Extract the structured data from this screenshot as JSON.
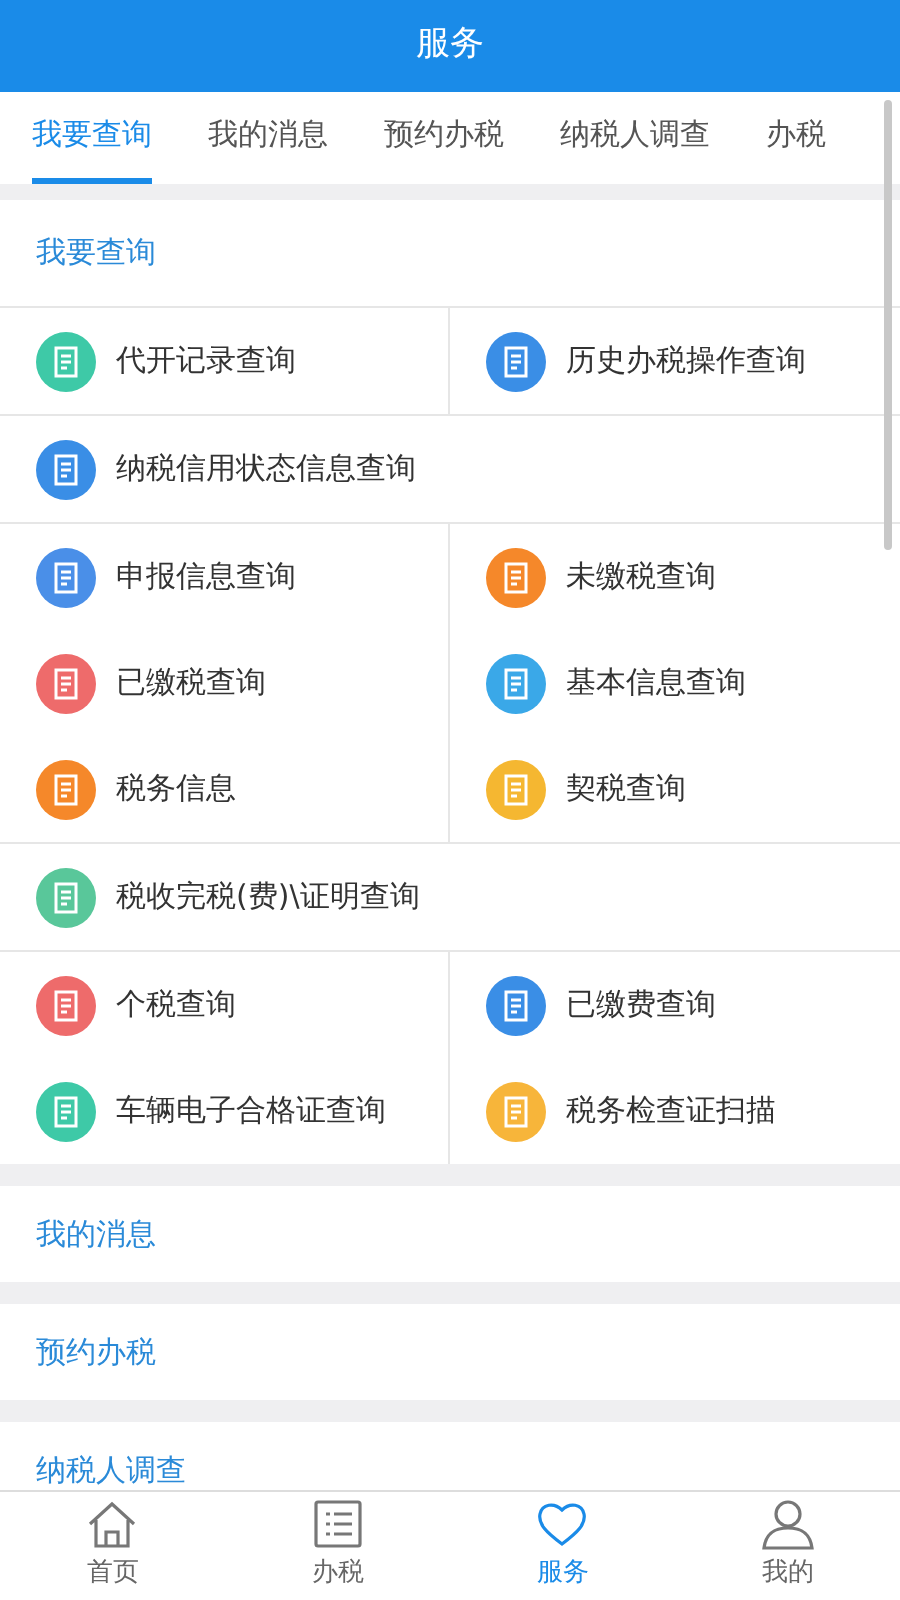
{
  "header": {
    "title": "服务"
  },
  "tabs": [
    {
      "label": "我要查询",
      "selected": true
    },
    {
      "label": "我的消息",
      "selected": false
    },
    {
      "label": "预约办税",
      "selected": false
    },
    {
      "label": "纳税人调查",
      "selected": false
    },
    {
      "label": "办税",
      "selected": false
    }
  ],
  "query_section": {
    "title": "我要查询",
    "blocks": [
      {
        "items": [
          {
            "label": "代开记录查询",
            "color": "#3ec9a7"
          },
          {
            "label": "历史办税操作查询",
            "color": "#3a8ee6"
          }
        ]
      },
      {
        "items": [
          {
            "label": "纳税信用状态信息查询",
            "color": "#3a8ee6"
          }
        ]
      },
      {
        "items": [
          {
            "label": "申报信息查询",
            "color": "#4a8fe8"
          },
          {
            "label": "未缴税查询",
            "color": "#f5882a"
          },
          {
            "label": "已缴税查询",
            "color": "#ee6b6b"
          },
          {
            "label": "基本信息查询",
            "color": "#3aa8e8"
          },
          {
            "label": "税务信息",
            "color": "#f5882a"
          },
          {
            "label": "契税查询",
            "color": "#f5b731"
          }
        ]
      },
      {
        "items": [
          {
            "label": "税收完税(费)\\证明查询",
            "color": "#59c79a"
          }
        ]
      },
      {
        "items": [
          {
            "label": "个税查询",
            "color": "#ee6b6b"
          },
          {
            "label": "已缴费查询",
            "color": "#3a8ee6"
          },
          {
            "label": "车辆电子合格证查询",
            "color": "#3ec9a7"
          },
          {
            "label": "税务检查证扫描",
            "color": "#f7b53a"
          }
        ]
      }
    ]
  },
  "other_sections": [
    {
      "title": "我的消息"
    },
    {
      "title": "预约办税"
    },
    {
      "title": "纳税人调查"
    }
  ],
  "bottom_nav": [
    {
      "label": "首页",
      "selected": false
    },
    {
      "label": "办税",
      "selected": false
    },
    {
      "label": "服务",
      "selected": true
    },
    {
      "label": "我的",
      "selected": false
    }
  ]
}
